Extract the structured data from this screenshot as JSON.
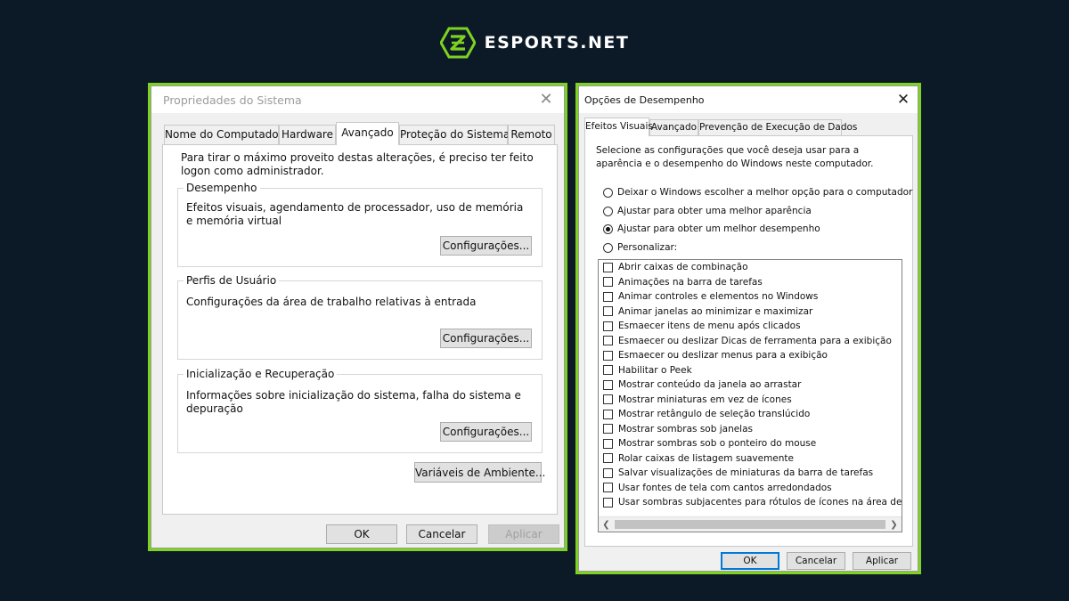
{
  "brand": {
    "name": "ESPORTS.NET",
    "accent": "#7ed321",
    "background": "#0c1a28"
  },
  "left_dialog": {
    "title": "Propriedades do Sistema",
    "tabs": [
      {
        "label": "Nome do Computador",
        "active": false
      },
      {
        "label": "Hardware",
        "active": false
      },
      {
        "label": "Avançado",
        "active": true
      },
      {
        "label": "Proteção do Sistema",
        "active": false
      },
      {
        "label": "Remoto",
        "active": false
      }
    ],
    "intro": "Para tirar o máximo proveito destas alterações, é preciso ter feito logon como administrador.",
    "groups": [
      {
        "title": "Desempenho",
        "description": "Efeitos visuais, agendamento de processador, uso de memória e memória virtual",
        "button": "Configurações..."
      },
      {
        "title": "Perfis de Usuário",
        "description": "Configurações da área de trabalho relativas à entrada",
        "button": "Configurações..."
      },
      {
        "title": "Inicialização e Recuperação",
        "description": "Informações sobre inicialização do sistema, falha do sistema e depuração",
        "button": "Configurações..."
      }
    ],
    "env_button": "Variáveis de Ambiente...",
    "footer": {
      "ok": "OK",
      "cancel": "Cancelar",
      "apply": "Aplicar"
    }
  },
  "right_dialog": {
    "title": "Opções de Desempenho",
    "tabs": [
      {
        "label": "Efeitos Visuais",
        "active": true
      },
      {
        "label": "Avançado",
        "active": false
      },
      {
        "label": "Prevenção de Execução de Dados",
        "active": false
      }
    ],
    "intro": "Selecione as configurações que você deseja usar para a aparência e o desempenho do Windows neste computador.",
    "options": [
      {
        "label": "Deixar o Windows escolher a melhor opção para o computador",
        "checked": false
      },
      {
        "label": "Ajustar para obter uma melhor aparência",
        "checked": false
      },
      {
        "label": "Ajustar para obter um melhor desempenho",
        "checked": true
      },
      {
        "label": "Personalizar:",
        "checked": false
      }
    ],
    "effects": [
      "Abrir caixas de combinação",
      "Animações na barra de tarefas",
      "Animar controles e elementos no Windows",
      "Animar janelas ao minimizar e maximizar",
      "Esmaecer itens de menu após clicados",
      "Esmaecer ou deslizar Dicas de ferramenta para a exibição",
      "Esmaecer ou deslizar menus para a exibição",
      "Habilitar o Peek",
      "Mostrar conteúdo da janela ao arrastar",
      "Mostrar miniaturas em vez de ícones",
      "Mostrar retângulo de seleção translúcido",
      "Mostrar sombras sob janelas",
      "Mostrar sombras sob o ponteiro do mouse",
      "Rolar caixas de listagem suavemente",
      "Salvar visualizações de miniaturas da barra de tarefas",
      "Usar fontes de tela com cantos arredondados",
      "Usar sombras subjacentes para rótulos de ícones na área de trabalho"
    ],
    "footer": {
      "ok": "OK",
      "cancel": "Cancelar",
      "apply": "Aplicar"
    }
  }
}
